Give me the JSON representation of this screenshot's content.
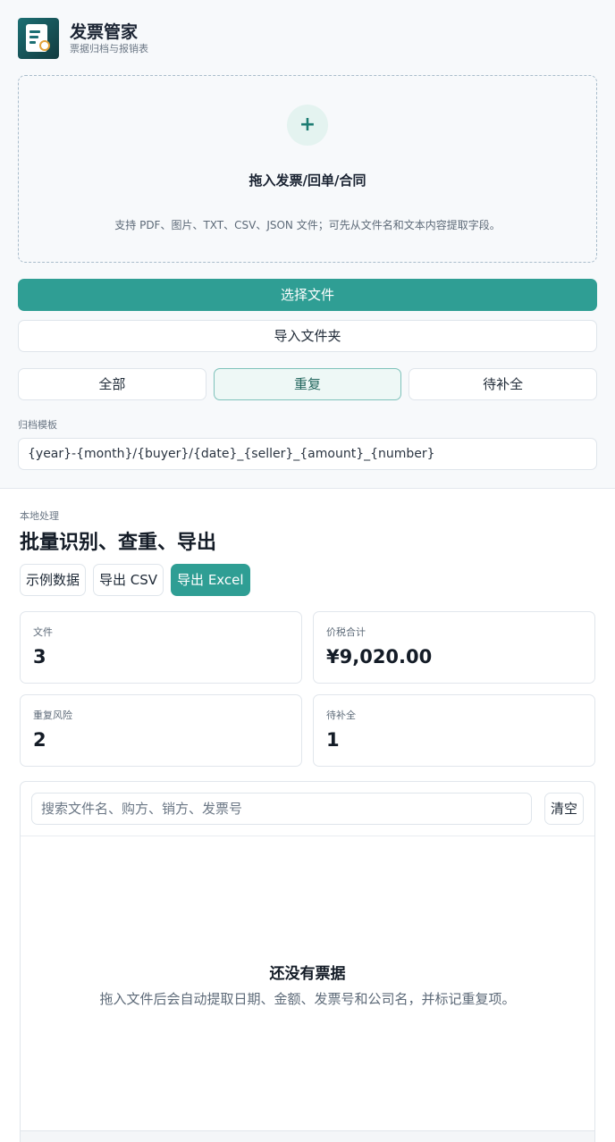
{
  "brand": {
    "title": "发票管家",
    "subtitle": "票据归档与报销表"
  },
  "dropzone": {
    "icon": "plus-icon",
    "title": "拖入发票/回单/合同",
    "hint": "支持 PDF、图片、TXT、CSV、JSON 文件；可先从文件名和文本内容提取字段。"
  },
  "buttons": {
    "choose_file": "选择文件",
    "import_folder": "导入文件夹"
  },
  "filters": [
    {
      "label": "全部",
      "active": false
    },
    {
      "label": "重复",
      "active": true
    },
    {
      "label": "待补全",
      "active": false
    }
  ],
  "template": {
    "label": "归档模板",
    "value": "{year}-{month}/{buyer}/{date}_{seller}_{amount}_{number}"
  },
  "main": {
    "eyebrow": "本地处理",
    "heading": "批量识别、查重、导出",
    "actions": {
      "sample": "示例数据",
      "export_csv": "导出 CSV",
      "export_excel": "导出 Excel"
    }
  },
  "stats": [
    {
      "label": "文件",
      "value": "3"
    },
    {
      "label": "价税合计",
      "value": "¥9,020.00"
    },
    {
      "label": "重复风险",
      "value": "2"
    },
    {
      "label": "待补全",
      "value": "1"
    }
  ],
  "search": {
    "placeholder": "搜索文件名、购方、销方、发票号",
    "clear": "清空"
  },
  "empty": {
    "title": "还没有票据",
    "hint": "拖入文件后会自动提取日期、金额、发票号和公司名，并标记重复项。"
  },
  "colors": {
    "accent": "#2f9e94",
    "background": "#f7f9fb"
  }
}
